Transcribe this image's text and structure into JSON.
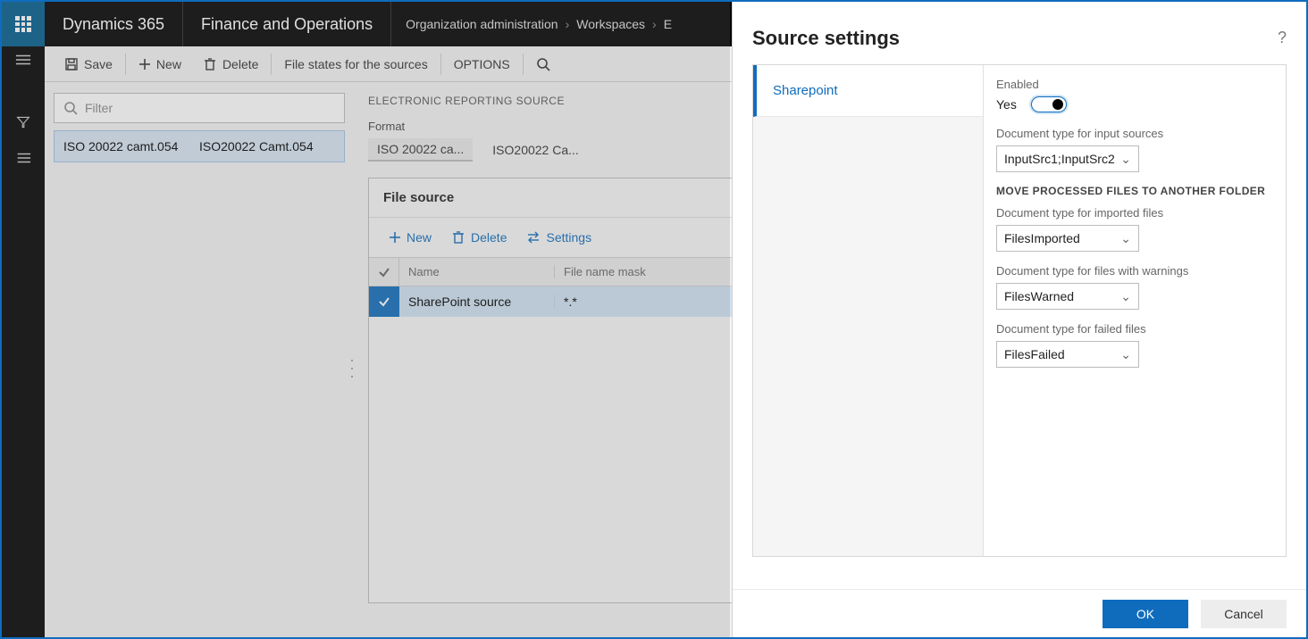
{
  "topnav": {
    "brand": "Dynamics 365",
    "module": "Finance and Operations",
    "breadcrumb": [
      "Organization administration",
      "Workspaces",
      "E"
    ]
  },
  "actionbar": {
    "save": "Save",
    "new": "New",
    "delete": "Delete",
    "file_states": "File states for the sources",
    "options": "OPTIONS"
  },
  "list": {
    "filter_placeholder": "Filter",
    "row": {
      "col1": "ISO 20022 camt.054",
      "col2": "ISO20022 Camt.054"
    }
  },
  "detail": {
    "title": "ELECTRONIC REPORTING SOURCE",
    "format_label": "Format",
    "format_tab1": "ISO 20022 ca...",
    "format_tab2": "ISO20022 Ca...",
    "card_title": "File source",
    "toolbar": {
      "new": "New",
      "delete": "Delete",
      "settings": "Settings"
    },
    "grid": {
      "headers": {
        "name": "Name",
        "mask": "File name mask"
      },
      "row": {
        "name": "SharePoint source",
        "mask": "*.*"
      }
    }
  },
  "panel": {
    "title": "Source settings",
    "tab": "Sharepoint",
    "enabled_label": "Enabled",
    "enabled_value": "Yes",
    "input_sources_label": "Document type for input sources",
    "input_sources_value": "InputSrc1;InputSrc2",
    "section": "MOVE PROCESSED FILES TO ANOTHER FOLDER",
    "imported_label": "Document type for imported files",
    "imported_value": "FilesImported",
    "warnings_label": "Document type for files with warnings",
    "warnings_value": "FilesWarned",
    "failed_label": "Document type for failed files",
    "failed_value": "FilesFailed",
    "ok": "OK",
    "cancel": "Cancel"
  }
}
